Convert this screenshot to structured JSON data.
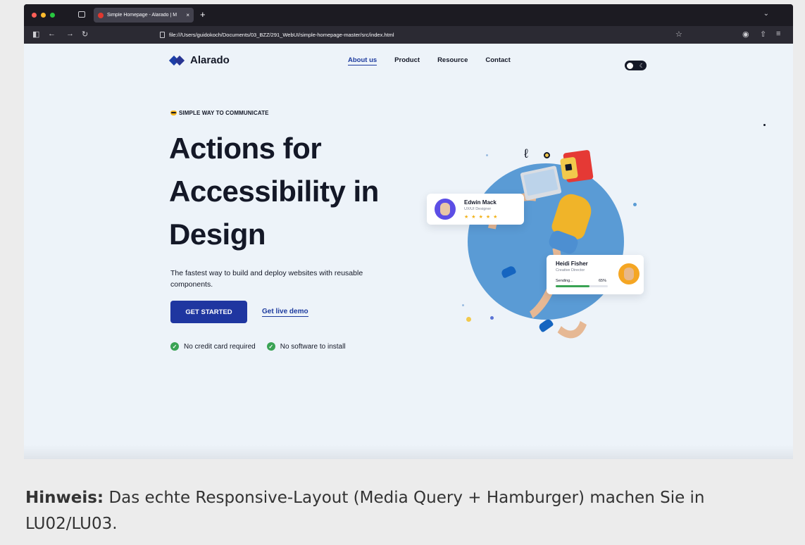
{
  "browser": {
    "tab_title": "Simple Homepage - Alarado | M",
    "tab_close": "×",
    "new_tab": "+",
    "tab_list": "⌄",
    "url": "file:///Users/guidokoch/Documents/03_BZZ/291_WebUI/simple-homepage-master/src/index.html",
    "icons": [
      "sidebar-icon",
      "back-icon",
      "forward-icon",
      "reload-icon",
      "bookmark-star-icon",
      "account-icon",
      "extensions-icon",
      "menu-icon"
    ]
  },
  "site": {
    "logo_text": "Alarado",
    "nav": [
      {
        "label": "About us",
        "active": true
      },
      {
        "label": "Product",
        "active": false
      },
      {
        "label": "Resource",
        "active": false
      },
      {
        "label": "Contact",
        "active": false
      }
    ],
    "hero": {
      "eyebrow": "SIMPLE WAY TO COMMUNICATE",
      "title_lines": [
        "Actions for",
        "Accessibility in",
        "Design"
      ],
      "description": "The fastest way to build and deploy websites with reusable components.",
      "cta_primary": "GET STARTED",
      "cta_secondary": "Get live demo",
      "checks": [
        "No credit card required",
        "No software to install"
      ]
    },
    "cards": {
      "edwin": {
        "name": "Edwin Mack",
        "role": "UX/UI Designer",
        "rating": 5
      },
      "heidi": {
        "name": "Heidi Fisher",
        "role": "Creative Director",
        "status": "Sending...",
        "progress_label": "65%",
        "progress": 0.65
      }
    }
  },
  "note": {
    "label": "Hinweis:",
    "text": "Das echte Responsive-Layout (Media Query + Hamburger) machen Sie in LU02/LU03."
  },
  "colors": {
    "primary": "#1f36a0",
    "page_bg": "#edf3f9",
    "success": "#3aa354",
    "accent_yellow": "#f2b21a"
  }
}
